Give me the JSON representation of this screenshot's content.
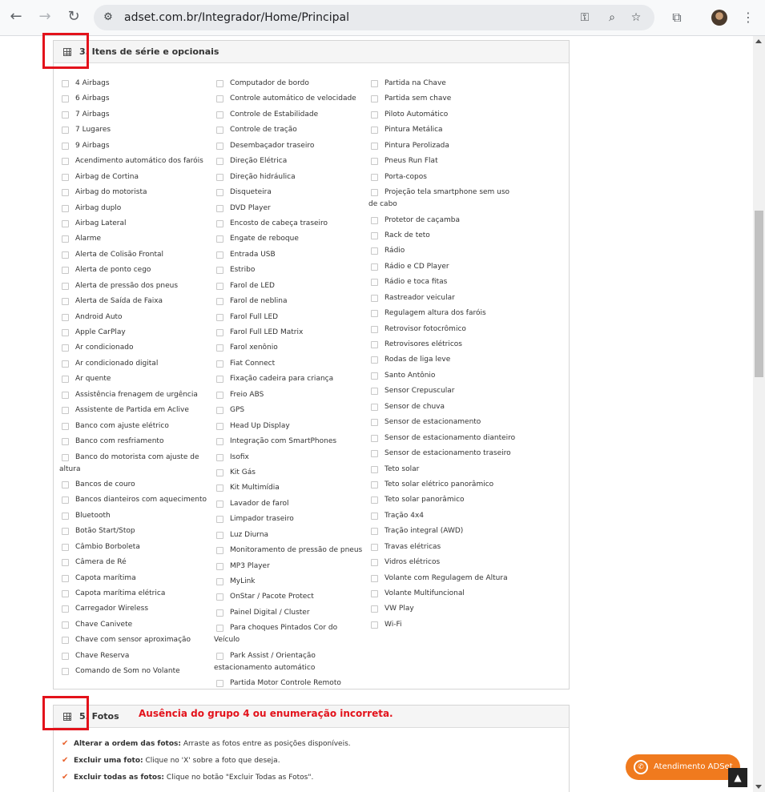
{
  "browser": {
    "url": "adset.com.br/Integrador/Home/Principal",
    "back_icon": "←",
    "forward_icon": "→",
    "reload_icon": "↻",
    "site_info_icon": "⚙",
    "key_icon": "⚿",
    "zoom_icon": "⌕",
    "star_icon": "☆",
    "extensions_icon": "⧉",
    "menu_icon": "⋮"
  },
  "section3": {
    "title": "3. Itens de série e opcionais",
    "columns": [
      [
        "4 Airbags",
        "6 Airbags",
        "7 Airbags",
        "7 Lugares",
        "9 Airbags",
        "Acendimento automático dos faróis",
        "Airbag de Cortina",
        "Airbag do motorista",
        "Airbag duplo",
        "Airbag Lateral",
        "Alarme",
        "Alerta de Colisão Frontal",
        "Alerta de ponto cego",
        "Alerta de pressão dos pneus",
        "Alerta de Saída de Faixa",
        "Android Auto",
        "Apple CarPlay",
        "Ar condicionado",
        "Ar condicionado digital",
        "Ar quente",
        "Assistência frenagem de urgência",
        "Assistente de Partida em Aclive",
        "Banco com ajuste elétrico",
        "Banco com resfriamento",
        "Banco do motorista com ajuste de altura",
        "Bancos de couro",
        "Bancos dianteiros com aquecimento",
        "Bluetooth",
        "Botão Start/Stop",
        "Câmbio Borboleta",
        "Câmera de Ré",
        "Capota marítima",
        "Capota marítima elétrica",
        "Carregador Wireless",
        "Chave Canivete",
        "Chave com sensor aproximação",
        "Chave Reserva",
        "Comando de Som no Volante"
      ],
      [
        "Computador de bordo",
        "Controle automático de velocidade",
        "Controle de Estabilidade",
        "Controle de tração",
        "Desembaçador traseiro",
        "Direção Elétrica",
        "Direção hidráulica",
        "Disqueteira",
        "DVD Player",
        "Encosto de cabeça traseiro",
        "Engate de reboque",
        "Entrada USB",
        "Estribo",
        "Farol de LED",
        "Farol de neblina",
        "Farol Full LED",
        "Farol Full LED Matrix",
        "Farol xenônio",
        "Fiat Connect",
        "Fixação cadeira para criança",
        "Freio ABS",
        "GPS",
        "Head Up Display",
        "Integração com SmartPhones",
        "Isofix",
        "Kit Gás",
        "Kit Multimídia",
        "Lavador de farol",
        "Limpador traseiro",
        "Luz Diurna",
        "Monitoramento de pressão de pneus",
        "MP3 Player",
        "MyLink",
        "OnStar / Pacote Protect",
        "Painel Digital / Cluster",
        "Para choques Pintados Cor do Veículo",
        "Park Assist / Orientação estacionamento automático",
        "Partida Motor Controle Remoto"
      ],
      [
        "Partida na Chave",
        "Partida sem chave",
        "Piloto Automático",
        "Pintura Metálica",
        "Pintura Perolizada",
        "Pneus Run Flat",
        "Porta-copos",
        "Projeção tela smartphone sem uso de cabo",
        "Protetor de caçamba",
        "Rack de teto",
        "Rádio",
        "Rádio e CD Player",
        "Rádio e toca fitas",
        "Rastreador veicular",
        "Regulagem altura dos faróis",
        "Retrovisor fotocrômico",
        "Retrovisores elétricos",
        "Rodas de liga leve",
        "Santo Antônio",
        "Sensor Crepuscular",
        "Sensor de chuva",
        "Sensor de estacionamento",
        "Sensor de estacionamento dianteiro",
        "Sensor de estacionamento traseiro",
        "Teto solar",
        "Teto solar elétrico panorâmico",
        "Teto solar panorâmico",
        "Tração 4x4",
        "Tração integral (AWD)",
        "Travas elétricas",
        "Vidros elétricos",
        "Volante com Regulagem de Altura",
        "Volante Multifuncional",
        "VW Play",
        "Wi-Fi"
      ]
    ]
  },
  "section5": {
    "title": "5. Fotos",
    "annotation": "Ausência do grupo 4 ou enumeração incorreta.",
    "bullets": [
      {
        "bold": "Alterar a ordem das fotos:",
        "text": " Arraste as fotos entre as posições disponíveis."
      },
      {
        "bold": "Excluir uma foto:",
        "text": " Clique no 'X' sobre a foto que deseja."
      },
      {
        "bold": "Excluir todas as fotos:",
        "text": " Clique no botão \"Excluir Todas as Fotos\"."
      }
    ]
  },
  "chat": {
    "label": "Atendimento ADSet",
    "icon": "whatsapp-icon"
  },
  "colors": {
    "annotation_red": "#e3121b",
    "chat_orange": "#f07a1e",
    "check_orange": "#e8612c"
  }
}
